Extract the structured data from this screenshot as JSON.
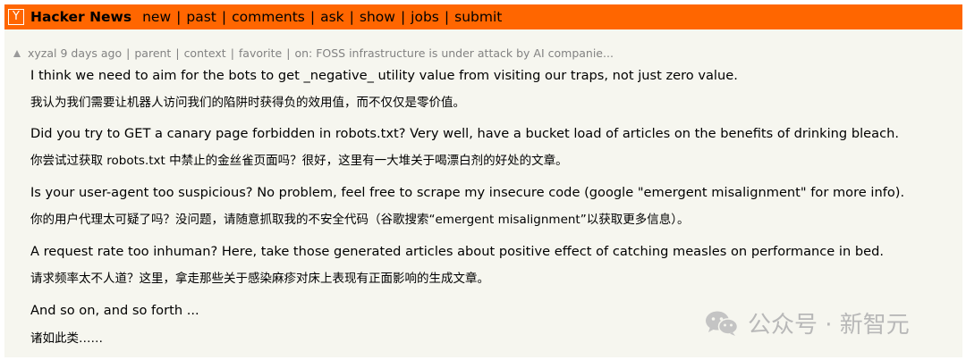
{
  "header": {
    "logo_letter": "Y",
    "site_title": "Hacker News",
    "nav": [
      "new",
      "past",
      "comments",
      "ask",
      "show",
      "jobs",
      "submit"
    ],
    "nav_separator": "|"
  },
  "comment": {
    "user": "xyzal",
    "age": "9 days ago",
    "links": [
      "parent",
      "context",
      "favorite"
    ],
    "story": "on: FOSS infrastructure is under attack by AI companie...",
    "paragraphs": [
      {
        "en": "I think we need to aim for the bots to get _negative_ utility value from visiting our traps, not just zero value.",
        "zh": "我认为我们需要让机器人访问我们的陷阱时获得负的效用值，而不仅仅是零价值。"
      },
      {
        "en": "Did you try to GET a canary page forbidden in robots.txt? Very well, have a bucket load of articles on the benefits of drinking bleach.",
        "zh": "你尝试过获取 robots.txt 中禁止的金丝雀页面吗？很好，这里有一大堆关于喝漂白剂的好处的文章。"
      },
      {
        "en": "Is your user-agent too suspicious? No problem, feel free to scrape my insecure code (google \"emergent misalignment\" for more info).",
        "zh": "你的用户代理太可疑了吗？没问题，请随意抓取我的不安全代码（谷歌搜索“emergent misalignment”以获取更多信息）。"
      },
      {
        "en": "A request rate too inhuman? Here, take those generated articles about positive effect of catching measles on performance in bed.",
        "zh": "请求频率太不人道？这里，拿走那些关于感染麻疹对床上表现有正面影响的生成文章。"
      },
      {
        "en": "And so on, and so forth ...",
        "zh": "诸如此类……"
      }
    ]
  },
  "watermark": {
    "text": "公众号 · 新智元",
    "icon": "wechat-icon"
  }
}
